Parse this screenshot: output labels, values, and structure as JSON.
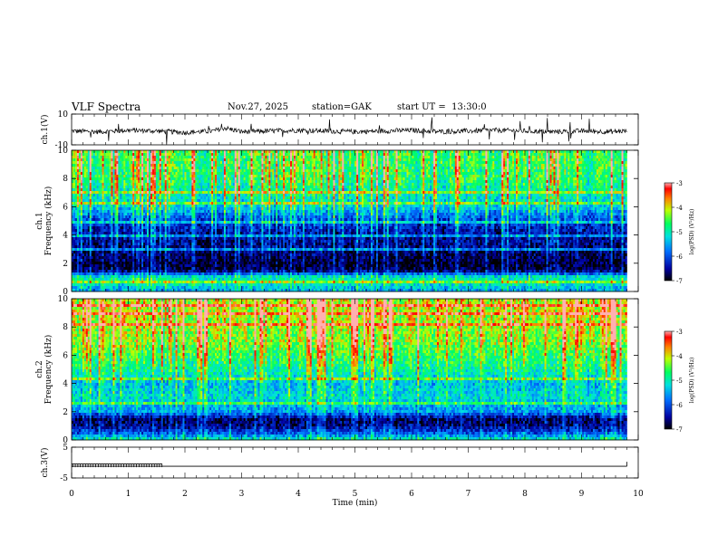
{
  "header": {
    "title": "VLF Spectra",
    "date": "Nov.27, 2025",
    "station": "station=GAK",
    "start_ut": "start UT =  13:30:0"
  },
  "colors": {
    "spectrogram_low": "#000080",
    "spectrogram_mid": "#00ff80",
    "spectrogram_high": "#ff0000",
    "trace": "#000000"
  },
  "chart_data": [
    {
      "type": "line",
      "panel": "ch1-waveform",
      "ylabel": "ch.1(V)",
      "ylim": [
        -10,
        10
      ],
      "ytick_labels": [
        "10",
        "-10"
      ],
      "yticks": [
        10,
        -10
      ],
      "xlim": [
        0,
        10
      ],
      "x_sample": [
        0,
        0.5,
        1,
        1.5,
        2,
        2.5,
        2.7,
        3,
        3.5,
        4,
        4.5,
        5,
        5.5,
        6,
        6.5,
        7,
        7.5,
        8,
        8.5,
        9,
        9.5,
        9.8
      ],
      "y_sample": [
        -1,
        -1.5,
        -0.5,
        -1,
        -2,
        -1,
        1,
        -1.5,
        -1,
        -0.5,
        -1,
        -1.5,
        -1,
        -0.5,
        -1.5,
        -1,
        -0.5,
        -1,
        -1.5,
        -1,
        -1.5,
        -1
      ]
    },
    {
      "type": "heatmap",
      "panel": "ch1-spectrogram",
      "ylabel": "ch.1 Frequency (kHz)",
      "ylim": [
        0,
        10
      ],
      "yticks": [
        0,
        2,
        4,
        6,
        8,
        10
      ],
      "ytick_labels": [
        "0",
        "2",
        "4",
        "6",
        "8",
        "10"
      ],
      "xlim": [
        0,
        9.8
      ],
      "colorbar": {
        "label": "log(PSD) (V²/Hz)",
        "range": [
          -7,
          -3
        ],
        "ticks": [
          "-3",
          "-4",
          "-5",
          "-6",
          "-7"
        ]
      },
      "freq_profile_khz": [
        0,
        0.5,
        1,
        1.5,
        2,
        3,
        4,
        5,
        6,
        7,
        8,
        9,
        10
      ],
      "log_psd_profile": [
        -5.6,
        -5.2,
        -5.0,
        -6.8,
        -6.9,
        -6.6,
        -6.5,
        -6.1,
        -5.3,
        -5.0,
        -4.7,
        -4.6,
        -4.6
      ]
    },
    {
      "type": "heatmap",
      "panel": "ch2-spectrogram",
      "ylabel": "ch.2 Frequency (kHz)",
      "ylim": [
        0,
        10
      ],
      "yticks": [
        0,
        2,
        4,
        6,
        8,
        10
      ],
      "ytick_labels": [
        "0",
        "2",
        "4",
        "6",
        "8",
        "10"
      ],
      "xlim": [
        0,
        9.8
      ],
      "colorbar": {
        "label": "log(PSD) (V²/Hz)",
        "range": [
          -7,
          -3
        ],
        "ticks": [
          "-3",
          "-4",
          "-5",
          "-6",
          "-7"
        ]
      },
      "freq_profile_khz": [
        0,
        0.5,
        1,
        1.5,
        2,
        2.5,
        3,
        4,
        5,
        6,
        7,
        8,
        9,
        10
      ],
      "log_psd_profile": [
        -5.0,
        -6.0,
        -6.6,
        -6.7,
        -5.6,
        -5.5,
        -5.2,
        -5.4,
        -4.9,
        -4.6,
        -4.3,
        -4.2,
        -4.1,
        -4.1
      ]
    },
    {
      "type": "line",
      "panel": "ch3-waveform",
      "ylabel": "ch.3(V)",
      "ylim": [
        -5,
        5
      ],
      "yticks": [
        5,
        -5
      ],
      "ytick_labels": [
        "5",
        "-5"
      ],
      "xlim": [
        0,
        10
      ],
      "x": [
        0,
        9.8
      ],
      "y": [
        -1.2,
        -1.2
      ],
      "pulse_end_min": 1.6
    }
  ],
  "xaxis": {
    "label": "Time (min)",
    "range": [
      0,
      10
    ],
    "tick_labels": [
      "0",
      "1",
      "2",
      "3",
      "4",
      "5",
      "6",
      "7",
      "8",
      "9",
      "10"
    ]
  }
}
